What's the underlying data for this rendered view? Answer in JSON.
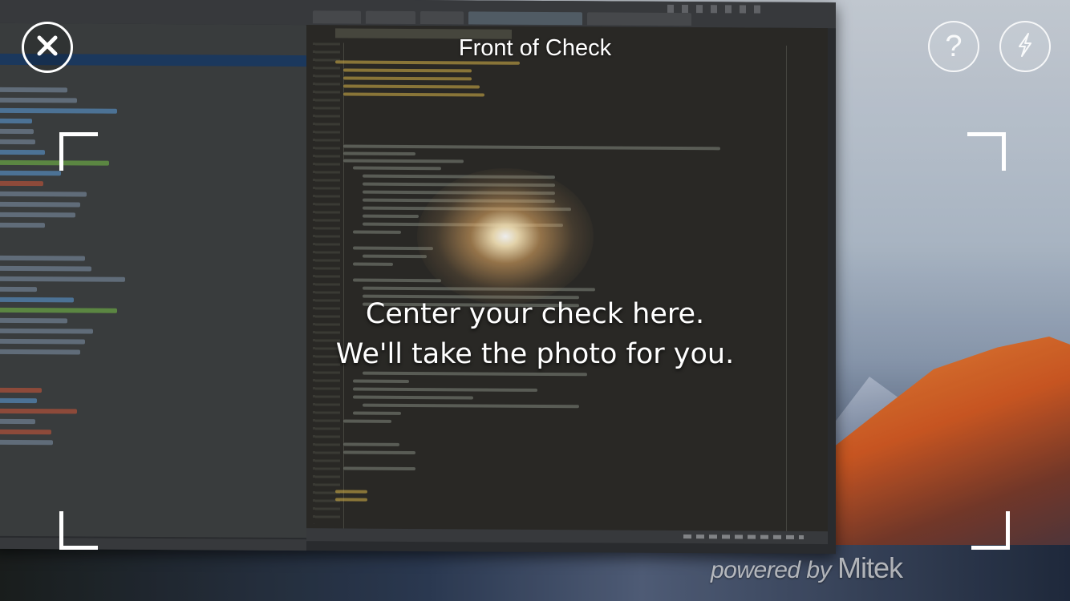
{
  "screen": {
    "title": "Front of Check",
    "instruction_line1": "Center your check here.",
    "instruction_line2": "We'll take the photo for you.",
    "powered_by_prefix": "powered by",
    "powered_by_brand": "Mitek"
  },
  "controls": {
    "close_icon": "close-icon",
    "help_icon": "help-icon",
    "help_glyph": "?",
    "flash_icon": "flash-icon"
  },
  "colors": {
    "overlay_text": "#ffffff",
    "frame_corner": "#ffffff",
    "brand_watermark": "#ffffffa6"
  }
}
